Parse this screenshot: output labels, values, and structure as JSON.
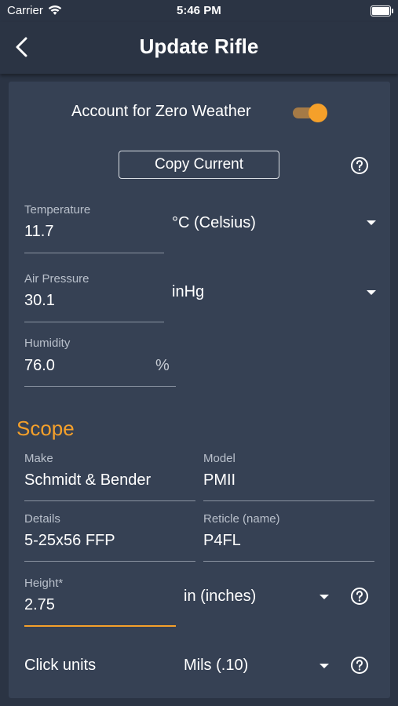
{
  "status_bar": {
    "carrier": "Carrier",
    "time": "5:46 PM"
  },
  "nav": {
    "title": "Update Rifle"
  },
  "zero_weather": {
    "label": "Account for Zero Weather",
    "enabled": true
  },
  "copy_button": {
    "label": "Copy Current"
  },
  "temperature": {
    "label": "Temperature",
    "value": "11.7",
    "unit": "°C (Celsius)"
  },
  "air_pressure": {
    "label": "Air Pressure",
    "value": "30.1",
    "unit": "inHg"
  },
  "humidity": {
    "label": "Humidity",
    "value": "76.0",
    "suffix": "%"
  },
  "scope": {
    "heading": "Scope",
    "make": {
      "label": "Make",
      "value": "Schmidt & Bender"
    },
    "model": {
      "label": "Model",
      "value": "PMII"
    },
    "details": {
      "label": "Details",
      "value": "5-25x56 FFP"
    },
    "reticle": {
      "label": "Reticle (name)",
      "value": "P4FL"
    },
    "height": {
      "label": "Height*",
      "value": "2.75",
      "unit": "in (inches)"
    },
    "click_units": {
      "label": "Click units",
      "value": "Mils (.10)"
    }
  },
  "colors": {
    "accent": "#f5a02a",
    "background": "#2b3444",
    "card": "#364154"
  }
}
